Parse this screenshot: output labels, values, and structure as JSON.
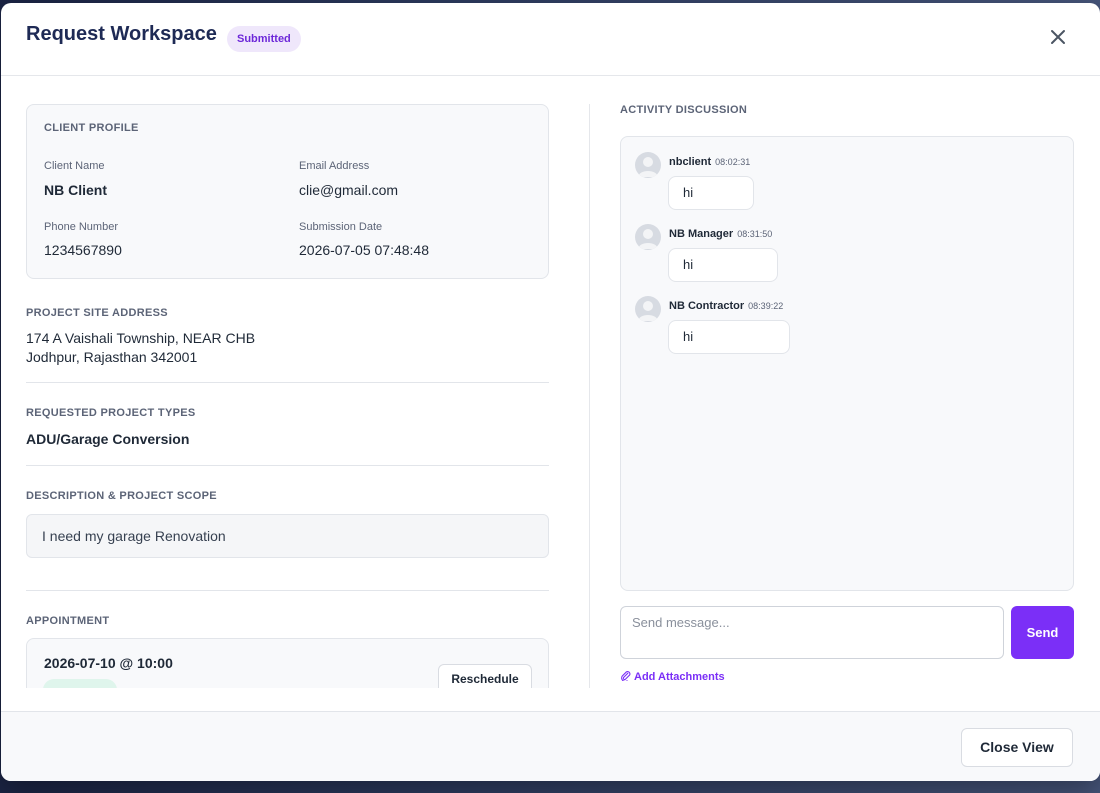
{
  "header": {
    "title": "Request Workspace",
    "status": "Submitted"
  },
  "client_profile": {
    "section_label": "CLIENT PROFILE",
    "client_name_label": "Client Name",
    "client_name": "NB Client",
    "email_label": "Email Address",
    "email": "clie@gmail.com",
    "phone_label": "Phone Number",
    "phone": "1234567890",
    "submission_label": "Submission Date",
    "submission_date": "2026-07-05 07:48:48"
  },
  "site_address": {
    "label": "PROJECT SITE ADDRESS",
    "line1": "174 A Vaishali Township, NEAR CHB",
    "line2": "Jodhpur, Rajasthan 342001"
  },
  "project_types": {
    "label": "REQUESTED PROJECT TYPES",
    "value": "ADU/Garage Conversion"
  },
  "description": {
    "label": "DESCRIPTION & PROJECT SCOPE",
    "value": "I need my garage Renovation"
  },
  "appointment": {
    "label": "APPOINTMENT",
    "datetime": "2026-07-10 @ 10:00",
    "reschedule_label": "Reschedule"
  },
  "activity": {
    "label": "ACTIVITY DISCUSSION",
    "messages": [
      {
        "author": "nbclient",
        "time": "08:02:31",
        "text": "hi"
      },
      {
        "author": "NB Manager",
        "time": "08:31:50",
        "text": "hi"
      },
      {
        "author": "NB Contractor",
        "time": "08:39:22",
        "text": "hi"
      }
    ],
    "input_placeholder": "Send message...",
    "send_label": "Send",
    "attach_label": "Add Attachments"
  },
  "footer": {
    "close_view_label": "Close View"
  },
  "colors": {
    "accent": "#7b2ff7",
    "title": "#1e2a55",
    "badge_bg": "#efe7fb"
  }
}
